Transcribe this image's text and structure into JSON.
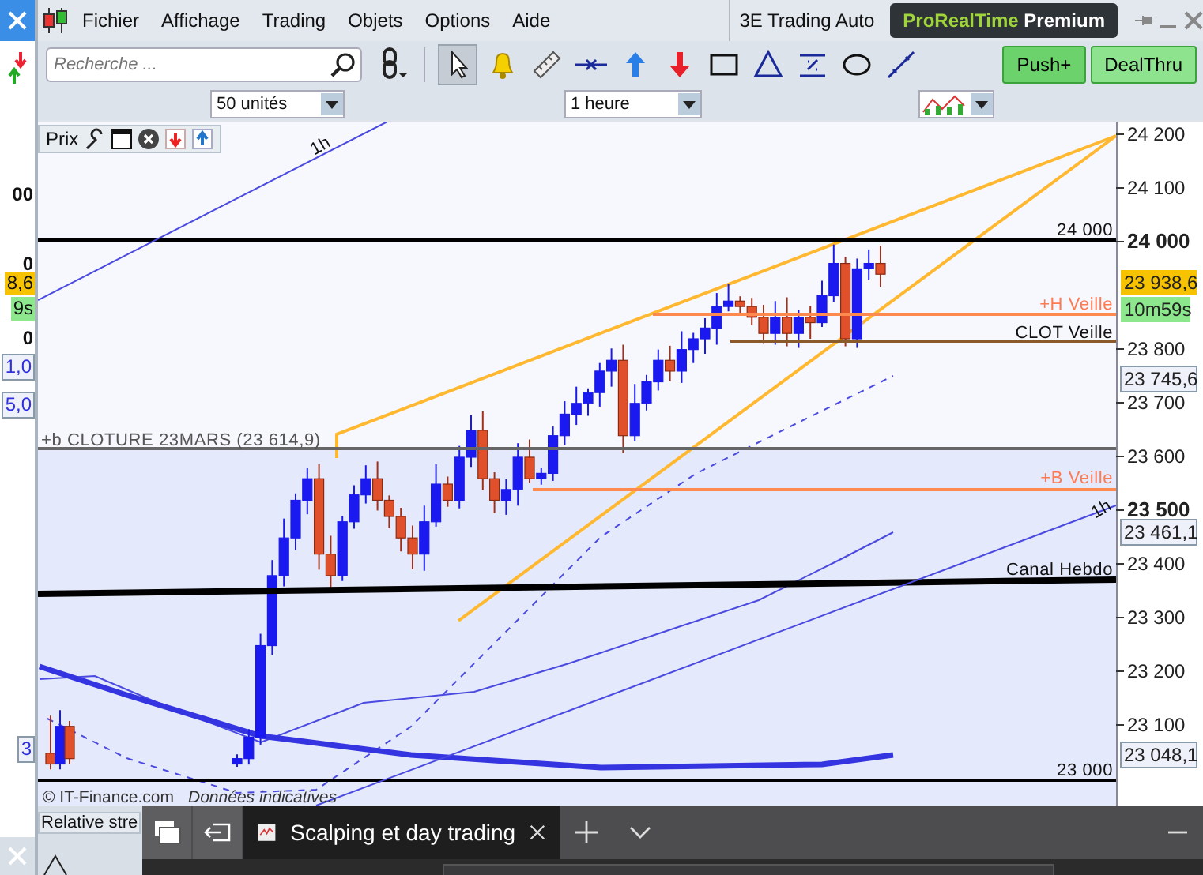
{
  "menu": [
    "Fichier",
    "Affichage",
    "Trading",
    "Objets",
    "Options",
    "Aide"
  ],
  "workspace": "3E Trading Auto",
  "brand": {
    "name": "ProRealTime",
    "edition": "Premium"
  },
  "search": {
    "placeholder": "Recherche ..."
  },
  "tools": [
    {
      "kind": "pointer",
      "selected": true
    },
    {
      "kind": "alert",
      "selected": false
    },
    {
      "kind": "ruler",
      "selected": false
    },
    {
      "kind": "hline",
      "selected": false
    },
    {
      "kind": "buy",
      "selected": false
    },
    {
      "kind": "sell",
      "selected": false
    },
    {
      "kind": "rect",
      "selected": false
    },
    {
      "kind": "triangle",
      "selected": false
    },
    {
      "kind": "percent",
      "selected": false
    },
    {
      "kind": "ellipse",
      "selected": false
    },
    {
      "kind": "line",
      "selected": false
    }
  ],
  "order_buttons": [
    "Push+",
    "DealThru"
  ],
  "units": "50 unités",
  "period": "1 heure",
  "panel": {
    "title": "Prix"
  },
  "axis_ticks": [
    {
      "label": "24 200",
      "bold": false
    },
    {
      "label": "24 100",
      "bold": false
    },
    {
      "label": "24 000",
      "bold": true
    },
    {
      "label": "23 800",
      "bold": false
    },
    {
      "label": "23 700",
      "bold": false
    },
    {
      "label": "23 600",
      "bold": false
    },
    {
      "label": "23 500",
      "bold": true
    },
    {
      "label": "23 400",
      "bold": false
    },
    {
      "label": "23 300",
      "bold": false
    },
    {
      "label": "23 200",
      "bold": false
    },
    {
      "label": "23 100",
      "bold": false
    }
  ],
  "price_tags": [
    {
      "label": "23 938,6",
      "kind": "last"
    },
    {
      "label": "10m59s",
      "kind": "timer"
    },
    {
      "label": "23 745,6",
      "kind": "indicator"
    },
    {
      "label": "23 461,1",
      "kind": "indicator"
    },
    {
      "label": "23 048,1",
      "kind": "indicator"
    }
  ],
  "lines": [
    {
      "label": "24 000",
      "kind": "level"
    },
    {
      "label": "+H Veille",
      "kind": "high"
    },
    {
      "label": "CLOT Veille",
      "kind": "close"
    },
    {
      "label": "+b CLOTURE 23MARS (23 614,9)",
      "kind": "cloture"
    },
    {
      "label": "+B Veille",
      "kind": "low"
    },
    {
      "label": "Canal Hebdo",
      "kind": "canal"
    },
    {
      "label": "23 000",
      "kind": "level"
    },
    {
      "label": "1h",
      "kind": "trend"
    },
    {
      "label": "1h",
      "kind": "trend"
    }
  ],
  "footer": {
    "copyright": "© IT-Finance.com",
    "note": "Données indicatives"
  },
  "indicator_panel": "Relative stre",
  "left_fragments": [
    {
      "label": "00",
      "kind": "tick"
    },
    {
      "label": "0",
      "kind": "tick"
    },
    {
      "label": "8,6",
      "kind": "last"
    },
    {
      "label": "9s",
      "kind": "timer"
    },
    {
      "label": "0",
      "kind": "tick"
    },
    {
      "label": "1,0",
      "kind": "indicator"
    },
    {
      "label": "5,0",
      "kind": "indicator"
    },
    {
      "label": "3",
      "kind": "indicator"
    }
  ],
  "browser_tab": {
    "title": "Scalping et day trading"
  }
}
